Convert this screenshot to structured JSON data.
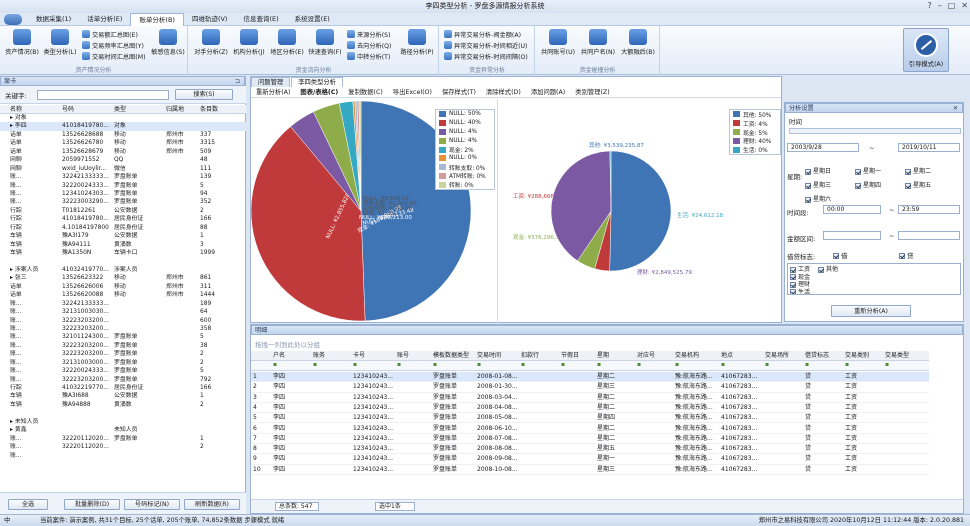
{
  "window": {
    "title": "李四类型分析 - 罗盘多源情报分析系统",
    "controls": [
      "?",
      "–",
      "□",
      "✕"
    ]
  },
  "menu": [
    "数据采集(1)",
    "话单分析(E)",
    "账单分析(B)",
    "四维轨迹(V)",
    "信息查询(E)",
    "系统设置(E)"
  ],
  "menu_active": 2,
  "ribbon": {
    "g1": {
      "label": "资产情况分析",
      "big": [
        "资产情况(B)",
        "类型分析(L)"
      ],
      "small": [
        "交易额汇总图(E)",
        "交易频率汇总图(Y)",
        "交易时间汇总图(M)"
      ],
      "big2": "敏感信息(S)"
    },
    "g2": {
      "label": "资金流向分析",
      "big": [
        "对手分析(Z)",
        "机构分析(J)",
        "地区分析(E)",
        "快速查询(F)"
      ],
      "small": [
        "来源分析(S)",
        "去向分析(Q)",
        "中转分析(T)"
      ],
      "big2": "路径分析(P)"
    },
    "g3": {
      "label": "资金异常分析",
      "small": [
        "异常交易分析-阀金额(A)",
        "异常交易分析-时间相近(U)",
        "异常交易分析-时间间隔(O)"
      ]
    },
    "g4": {
      "label": "资金碰撞分析",
      "big": [
        "共同账号(U)",
        "共同户名(N)",
        "大额融后(B)"
      ]
    },
    "guide": "引导模式(A)"
  },
  "left": {
    "header": "案卡",
    "keyword_label": "关键字:",
    "search_btn": "搜索(S)",
    "columns": [
      "名称",
      "号码",
      "类型",
      "归属地",
      "条目数"
    ],
    "rows": [
      [
        "▸ 对象",
        "",
        "",
        "",
        ""
      ],
      [
        "  ▸ 李四",
        "41018419780...",
        "对象",
        "",
        ""
      ],
      [
        "    话单",
        "13526628688",
        "移动",
        "郑州市",
        "337"
      ],
      [
        "    话单",
        "13526626780",
        "移动",
        "郑州市",
        "3315"
      ],
      [
        "    话单",
        "13526628679",
        "移动",
        "郑州市",
        "509"
      ],
      [
        "    网聊",
        "2059971552",
        "QQ",
        "",
        "48"
      ],
      [
        "    网聊",
        "wxid_iuUoylir...",
        "微信",
        "",
        "111"
      ],
      [
        "    账...",
        "32242133333...",
        "罗盘账单",
        "",
        "139"
      ],
      [
        "    账...",
        "32220024333...",
        "罗盘账单",
        "",
        "5"
      ],
      [
        "    账...",
        "12341024303...",
        "罗盘账单",
        "",
        "94"
      ],
      [
        "    账...",
        "32223003290...",
        "罗盘账单",
        "",
        "352"
      ],
      [
        "    行踪",
        "T01812261",
        "公安数据",
        "",
        "2"
      ],
      [
        "    行踪",
        "41018419780...",
        "居民身份证",
        "",
        "166"
      ],
      [
        "    行踪",
        "4.10184197800",
        "居民身份证",
        "",
        "88"
      ],
      [
        "    车辆",
        "豫A3I179",
        "公安数据",
        "",
        "1"
      ],
      [
        "    车辆",
        "豫A94111",
        "黄涌数",
        "",
        "3"
      ],
      [
        "    车辆",
        "豫A1350N",
        "车辆卡口",
        "",
        "1999"
      ],
      [
        "",
        "",
        " ",
        "",
        ""
      ],
      [
        "▸ 涉案人员",
        "41032419770...",
        "涉案人员",
        "",
        ""
      ],
      [
        "  ▸ 张三",
        "13526623322",
        "移动",
        "郑州市",
        "861"
      ],
      [
        "    话单",
        "13526626006",
        "移动",
        "郑州市",
        "311"
      ],
      [
        "    话单",
        "13526620088",
        "移动",
        "郑州市",
        "1444"
      ],
      [
        "    账...",
        "32242133333...",
        "",
        "",
        "189"
      ],
      [
        "    账...",
        "32131003030...",
        "",
        "",
        "64"
      ],
      [
        "    账...",
        "32223203200...",
        "",
        "",
        "600"
      ],
      [
        "    账...",
        "32223203200...",
        "",
        "",
        "358"
      ],
      [
        "    账...",
        "32101124300...",
        "罗盘账单",
        "",
        "5"
      ],
      [
        "    账...",
        "32223203200...",
        "罗盘账单",
        "",
        "38"
      ],
      [
        "    账...",
        "32223203200...",
        "罗盘账单",
        "",
        "2"
      ],
      [
        "    账...",
        "32131003000...",
        "罗盘账单",
        "",
        "2"
      ],
      [
        "    账...",
        "32220024333...",
        "罗盘账单",
        "",
        "5"
      ],
      [
        "    账...",
        "32223203200...",
        "罗盘账单",
        "",
        "792"
      ],
      [
        "    行踪",
        "41032219770...",
        "居民身份证",
        "",
        "166"
      ],
      [
        "    车辆",
        "豫A3I688",
        "公安数据",
        "",
        "1"
      ],
      [
        "    车辆",
        "豫A94888",
        "黄涌数",
        "",
        "2"
      ],
      [
        "",
        "",
        " ",
        "",
        ""
      ],
      [
        "▸ 未知人员",
        "",
        "",
        "",
        ""
      ],
      [
        "  ▸ 黄鑫",
        "",
        "未知人员",
        "",
        ""
      ],
      [
        "    账...",
        "32220112020...",
        "罗盘账单",
        "",
        "1"
      ],
      [
        "    账...",
        "32220112020...",
        "",
        "",
        "2"
      ],
      [
        "    账...",
        "",
        "",
        "",
        ""
      ]
    ],
    "bottom_btns": [
      "全选",
      "批量删除(D)",
      "号码标记(N)",
      "刷新数据(R)"
    ]
  },
  "tabs": [
    "问题管理",
    "李四类型分析"
  ],
  "toolbar": [
    "重新分析(A)",
    "图表/表格(C)",
    "复制数据(C)",
    "导出Excel(O)",
    "保存样式(T)",
    "清除样式(D)",
    "添加问题(A)",
    "类别管理(Z)"
  ],
  "chart_data": [
    {
      "type": "pie",
      "series_label": "left",
      "slices": [
        {
          "name": "NULL",
          "percent": 50,
          "color": "#3f74b5",
          "label": "NULL: ¥3,538,338.52"
        },
        {
          "name": "NULL",
          "percent": 40,
          "color": "#c0393b",
          "label": "NULL: ¥2,855,828.09"
        },
        {
          "name": "NULL",
          "percent": 4,
          "color": "#7b59a3",
          "label": "NULL: ¥300,213.00"
        },
        {
          "name": "NULL",
          "percent": 4,
          "color": "#8fac4b",
          "label": "NULL: ¥269,133.48"
        },
        {
          "name": "现金",
          "percent": 2,
          "color": "#35a8c4",
          "label": "现金: ¥188,880.99"
        },
        {
          "name": "NULL",
          "percent": 0,
          "color": "#e7923a",
          "label": "NULL: ¥8,596.52"
        },
        {
          "name": "转账支取",
          "percent": 0,
          "color": "#a9b9d6",
          "label": "转账支取: ¥1,000.00"
        },
        {
          "name": "ATM转账",
          "percent": 0,
          "color": "#d19c9b",
          "label": "ATM转账: ¥300.00"
        },
        {
          "name": "转账",
          "percent": 0,
          "color": "#c7d59d",
          "label": "转账: ¥3.00"
        }
      ],
      "legend": [
        "NULL: 50%",
        "NULL: 40%",
        "NULL: 4%",
        "NULL: 4%",
        "现金: 2%",
        "NULL: 0%",
        "转账支取: 0%",
        "ATM转账: 0%",
        "转账: 0%"
      ]
    },
    {
      "type": "pie",
      "series_label": "right",
      "slices": [
        {
          "name": "其他",
          "percent": 50,
          "color": "#3f74b5",
          "label": "其他: ¥3,539,235.87"
        },
        {
          "name": "工资",
          "percent": 4,
          "color": "#c0393b",
          "label": "工资: ¥288,666.61"
        },
        {
          "name": "现金",
          "percent": 5,
          "color": "#8fac4b",
          "label": "现金: ¥376,296.56"
        },
        {
          "name": "理财",
          "percent": 40,
          "color": "#7b59a3",
          "label": "理财: ¥2,849,525.79"
        },
        {
          "name": "生活",
          "percent": 0,
          "color": "#35a8c4",
          "label": "生活: ¥24,612.18"
        }
      ],
      "legend": [
        "其他: 50%",
        "工资: 4%",
        "现金: 5%",
        "理财: 40%",
        "生活: 0%"
      ]
    }
  ],
  "settings": {
    "header": "分析设置",
    "time_label": "时间",
    "date_from": "2003/9/28",
    "date_to": "2019/10/11",
    "weekday_label": "星期:",
    "weekdays": [
      "星期日",
      "星期一",
      "星期二",
      "星期三",
      "星期四",
      "星期五",
      "星期六"
    ],
    "timespan_label": "时间段:",
    "time_from": "00:00",
    "time_to": "23:59",
    "amount_label": "金额区间:",
    "sep": "~",
    "flag_label": "借贷标志:",
    "debit": "借",
    "credit": "贷",
    "categories": [
      "工资",
      "其他",
      "现金",
      "理财",
      "生活"
    ],
    "reanalyze": "重新分析(A)"
  },
  "detail": {
    "header": "明细",
    "drag_hint": "拖拽一列到此处以分组",
    "columns": [
      "",
      "户名",
      "账务",
      "卡号",
      "账号",
      "模板数据类型",
      "交易时间",
      "扣款行",
      "节假日",
      "星期",
      "对应号",
      "交易机构",
      "地点",
      "交易场所",
      "借贷标志",
      "交易类别",
      "交易类型"
    ],
    "rows": [
      [
        "1",
        "李四",
        "",
        "123410243...",
        "",
        "罗盘账单",
        "2008-01-08...",
        "",
        "",
        "星期二",
        "",
        "豫:航海东路...",
        "41067283...",
        "",
        "贷",
        "工资",
        ""
      ],
      [
        "2",
        "李四",
        "",
        "123410243...",
        "",
        "罗盘账单",
        "2008-01-30...",
        "",
        "",
        "星期三",
        "",
        "豫:航海东路...",
        "41067283...",
        "",
        "贷",
        "工资",
        ""
      ],
      [
        "3",
        "李四",
        "",
        "123410243...",
        "",
        "罗盘账单",
        "2008-03-04...",
        "",
        "",
        "星期二",
        "",
        "豫:航海东路...",
        "41067283...",
        "",
        "贷",
        "工资",
        ""
      ],
      [
        "4",
        "李四",
        "",
        "123410243...",
        "",
        "罗盘账单",
        "2008-04-08...",
        "",
        "",
        "星期二",
        "",
        "豫:航海东路...",
        "41067283...",
        "",
        "贷",
        "工资",
        ""
      ],
      [
        "5",
        "李四",
        "",
        "123410243...",
        "",
        "罗盘账单",
        "2008-05-08...",
        "",
        "",
        "星期四",
        "",
        "豫:航海东路...",
        "41067283...",
        "",
        "贷",
        "工资",
        ""
      ],
      [
        "6",
        "李四",
        "",
        "123410243...",
        "",
        "罗盘账单",
        "2008-06-10...",
        "",
        "",
        "星期二",
        "",
        "豫:航海东路...",
        "41067283...",
        "",
        "贷",
        "工资",
        ""
      ],
      [
        "7",
        "李四",
        "",
        "123410243...",
        "",
        "罗盘账单",
        "2008-07-08...",
        "",
        "",
        "星期二",
        "",
        "豫:航海东路...",
        "41067283...",
        "",
        "贷",
        "工资",
        ""
      ],
      [
        "8",
        "李四",
        "",
        "123410243...",
        "",
        "罗盘账单",
        "2008-08-08...",
        "",
        "",
        "星期五",
        "",
        "豫:航海东路...",
        "41067283...",
        "",
        "贷",
        "工资",
        ""
      ],
      [
        "9",
        "李四",
        "",
        "123410243...",
        "",
        "罗盘账单",
        "2008-09-08...",
        "",
        "",
        "星期一",
        "",
        "豫:航海东路...",
        "41067283...",
        "",
        "贷",
        "工资",
        ""
      ],
      [
        "10",
        "李四",
        "",
        "123410243...",
        "",
        "罗盘账单",
        "2008-10-08...",
        "",
        "",
        "星期三",
        "",
        "豫:航海东路...",
        "41067283...",
        "",
        "贷",
        "工资",
        ""
      ]
    ],
    "total": "总条数: 547",
    "selected": "选中1条"
  },
  "status": {
    "left": "当前案件: 演示案例, 共31个目标, 25个话单, 205个账单, 74,852条数据  步骤模式  就绪",
    "right": "郑州市之易科技有限公司    2020年10月12日 11:12:44    版本: 2.0.20.881"
  }
}
